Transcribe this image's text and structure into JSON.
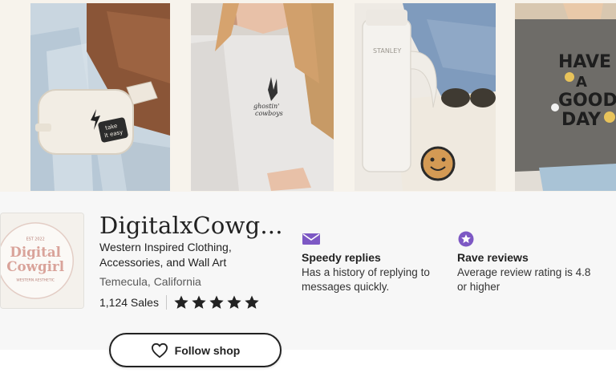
{
  "banner": {
    "images": [
      {
        "name": "fanny-pack-photo",
        "patch_line1": "take",
        "patch_line2": "it easy"
      },
      {
        "name": "ghostin-cowboys-sweatshirt-photo",
        "print_line1": "ghostin'",
        "print_line2": "cowboys"
      },
      {
        "name": "stanley-tumbler-photo",
        "brand": "STANLEY"
      },
      {
        "name": "have-a-good-day-tee-photo",
        "print_line1": "HAVE",
        "print_line2": "A",
        "print_line3": "GOOD",
        "print_line4": "DAY"
      }
    ]
  },
  "shop": {
    "logo": {
      "top_text": "EST 2022",
      "line1": "Digital",
      "line2": "Cowgirl",
      "bottom_text": "WESTERN AESTHETIC"
    },
    "name": "DigitalxCowg...",
    "description": "Western Inspired Clothing, Accessories, and Wall Art",
    "location": "Temecula, California",
    "sales": "1,124 Sales",
    "rating": 5,
    "star_color": "#222222"
  },
  "features": [
    {
      "icon": "envelope-icon",
      "title": "Speedy replies",
      "description": "Has a history of replying to messages quickly."
    },
    {
      "icon": "star-badge-icon",
      "title": "Rave reviews",
      "description": "Average review rating is 4.8 or higher"
    }
  ],
  "follow_button": {
    "icon": "heart-icon",
    "label": "Follow shop"
  },
  "colors": {
    "accent_purple": "#7d58c4",
    "text": "#222222",
    "band": "#f7f7f7",
    "logo_pink": "#d9a39a"
  }
}
